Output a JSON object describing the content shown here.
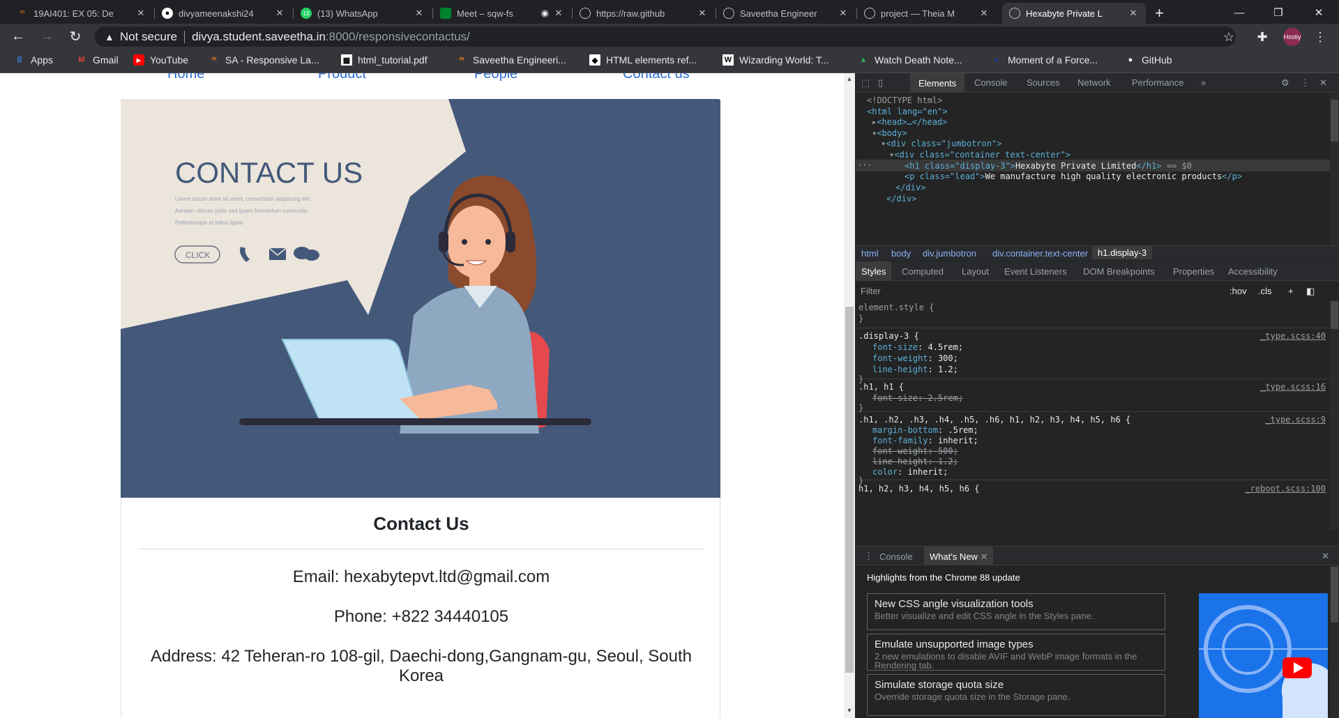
{
  "browser": {
    "tabs": [
      {
        "title": "19AI401: EX 05: De",
        "icon": "moodle-icon"
      },
      {
        "title": "divyameenakshi24",
        "icon": "github-icon"
      },
      {
        "title": "(13) WhatsApp",
        "icon": "whatsapp-icon"
      },
      {
        "title": "Meet – sqw-fs",
        "icon": "meet-icon"
      },
      {
        "title": "https://raw.github",
        "icon": "globe-icon"
      },
      {
        "title": "Saveetha Engineer",
        "icon": "globe-icon"
      },
      {
        "title": "project — Theia M",
        "icon": "globe-icon"
      },
      {
        "title": "Hexabyte Private L",
        "icon": "globe-icon",
        "active": true
      }
    ],
    "whatsapp_badge": "13",
    "address": {
      "security": "Not secure",
      "host": "divya.student.saveetha.in",
      "path": ":8000/responsivecontactus/"
    },
    "bookmarks": [
      {
        "label": "Apps",
        "icon": "apps-grid-icon"
      },
      {
        "label": "Gmail",
        "icon": "gmail-icon"
      },
      {
        "label": "YouTube",
        "icon": "youtube-icon"
      },
      {
        "label": "SA - Responsive La...",
        "icon": "moodle-icon"
      },
      {
        "label": "html_tutorial.pdf",
        "icon": "pdf-icon"
      },
      {
        "label": "Saveetha Engineeri...",
        "icon": "moodle-icon"
      },
      {
        "label": "HTML elements ref...",
        "icon": "mdn-icon"
      },
      {
        "label": "Wizarding World: T...",
        "icon": "wizarding-icon"
      },
      {
        "label": "Watch Death Note...",
        "icon": "stream-icon"
      },
      {
        "label": "Moment of a Force...",
        "icon": "circle-icon"
      },
      {
        "label": "GitHub",
        "icon": "github-icon"
      }
    ],
    "avatar_text": "Hsstiy"
  },
  "page": {
    "nav": [
      "Home",
      "Product",
      "People",
      "Contact us"
    ],
    "hero": {
      "heading": "CONTACT US",
      "lorem": [
        "Lorem ipsum dolor sit amet, consectetur adipiscing elit.",
        "Aenean ultrices justo sed quam fermentum commodo.",
        "Pellentesque at tellus ligula"
      ],
      "button": "CLICK"
    },
    "card": {
      "title": "Contact Us",
      "email": "Email: hexabytepvt.ltd@gmail.com",
      "phone": "Phone: +822 34440105",
      "address": "Address: 42 Teheran-ro 108-gil, Daechi-dong,Gangnam-gu, Seoul, South Korea"
    }
  },
  "devtools": {
    "tabs": [
      "Elements",
      "Console",
      "Sources",
      "Network",
      "Performance"
    ],
    "more": "»",
    "dom": {
      "doctype": "<!DOCTYPE html>",
      "html_open": "<html lang=\"en\">",
      "head": "<head>…</head>",
      "body": "<body>",
      "div_jumbo": "<div class=\"jumbotron\">",
      "div_container": "<div class=\"container text-center\">",
      "h1_open": "<h1 class=\"display-3\">",
      "h1_text": "Hexabyte Private Limited",
      "h1_close": "</h1>",
      "h1_marker": "== $0",
      "p_open": "<p class=\"lead\">",
      "p_text": "We manufacture high quality electronic products",
      "p_close": "</p>",
      "div_close": "</div>",
      "div_close2": "</div>"
    },
    "breadcrumbs": [
      "html",
      "body",
      "div.jumbotron",
      "div.container.text-center",
      "h1.display-3"
    ],
    "subtabs": [
      "Styles",
      "Computed",
      "Layout",
      "Event Listeners",
      "DOM Breakpoints",
      "Properties",
      "Accessibility"
    ],
    "filter_placeholder": "Filter",
    "hov": ":hov",
    "cls": ".cls",
    "rules": [
      {
        "selector": "element.style {",
        "close": "}",
        "props": []
      },
      {
        "selector": ".display-3 {",
        "source": "_type.scss:40",
        "close": "}",
        "props": [
          {
            "name": "font-size",
            "value": "4.5rem;"
          },
          {
            "name": "font-weight",
            "value": "300;"
          },
          {
            "name": "line-height",
            "value": "1.2;"
          }
        ]
      },
      {
        "selector": ".h1, h1 {",
        "source": "_type.scss:16",
        "close": "}",
        "props": [
          {
            "name": "font-size",
            "value": "2.5rem;",
            "struck": true
          }
        ]
      },
      {
        "selector": ".h1, .h2, .h3, .h4, .h5, .h6, h1, h2, h3, h4, h5, h6 {",
        "source": "_type.scss:9",
        "close": "}",
        "props": [
          {
            "name": "margin-bottom",
            "value": ".5rem;"
          },
          {
            "name": "font-family",
            "value": "inherit;"
          },
          {
            "name": "font-weight",
            "value": "500;",
            "struck": true
          },
          {
            "name": "line-height",
            "value": "1.2;",
            "struck": true
          },
          {
            "name": "color",
            "value": "inherit;"
          }
        ]
      },
      {
        "selector": "h1, h2, h3, h4, h5, h6 {",
        "source": "_reboot.scss:100",
        "props": []
      }
    ],
    "drawer": {
      "tabs": [
        "Console",
        "What's New"
      ],
      "heading": "Highlights from the Chrome 88 update",
      "items": [
        {
          "title": "New CSS angle visualization tools",
          "desc": "Better visualize and edit CSS angle in the Styles pane."
        },
        {
          "title": "Emulate unsupported image types",
          "desc": "2 new emulations to disable AVIF and WebP image formats in the Rendering tab."
        },
        {
          "title": "Simulate storage quota size",
          "desc": "Override storage quota size in the Storage pane."
        }
      ]
    }
  },
  "colors": {
    "hero_bg": "#44597a",
    "bubble": "#ece5dc",
    "link": "#2f6fd6",
    "devtools_bg": "#242424"
  }
}
